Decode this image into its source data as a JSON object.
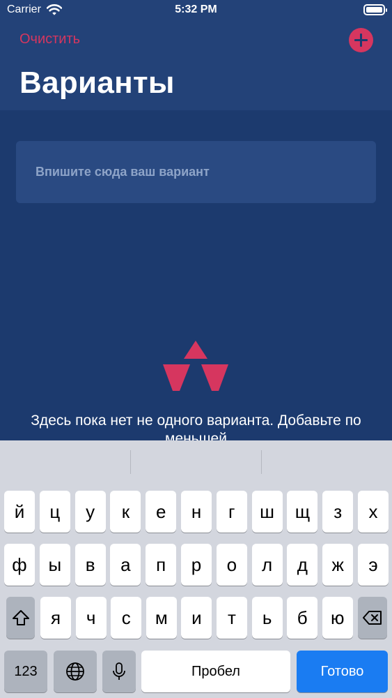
{
  "status_bar": {
    "carrier": "Carrier",
    "time": "5:32 PM"
  },
  "header": {
    "clear_label": "Очистить",
    "title": "Варианты"
  },
  "input": {
    "placeholder": "Впишите сюда ваш вариант",
    "value": ""
  },
  "empty_state": {
    "message": "Здесь пока нет не одного варианта. Добавьте по меньшей"
  },
  "keyboard": {
    "row1": [
      "й",
      "ц",
      "у",
      "к",
      "е",
      "н",
      "г",
      "ш",
      "щ",
      "з",
      "х"
    ],
    "row2": [
      "ф",
      "ы",
      "в",
      "а",
      "п",
      "р",
      "о",
      "л",
      "д",
      "ж",
      "э"
    ],
    "row3": [
      "я",
      "ч",
      "с",
      "м",
      "и",
      "т",
      "ь",
      "б",
      "ю"
    ],
    "numbers_label": "123",
    "space_label": "Пробел",
    "done_label": "Готово"
  },
  "colors": {
    "accent": "#d6365f",
    "background": "#1c3a6e",
    "header": "#234278",
    "done_button": "#1a7cf2"
  }
}
